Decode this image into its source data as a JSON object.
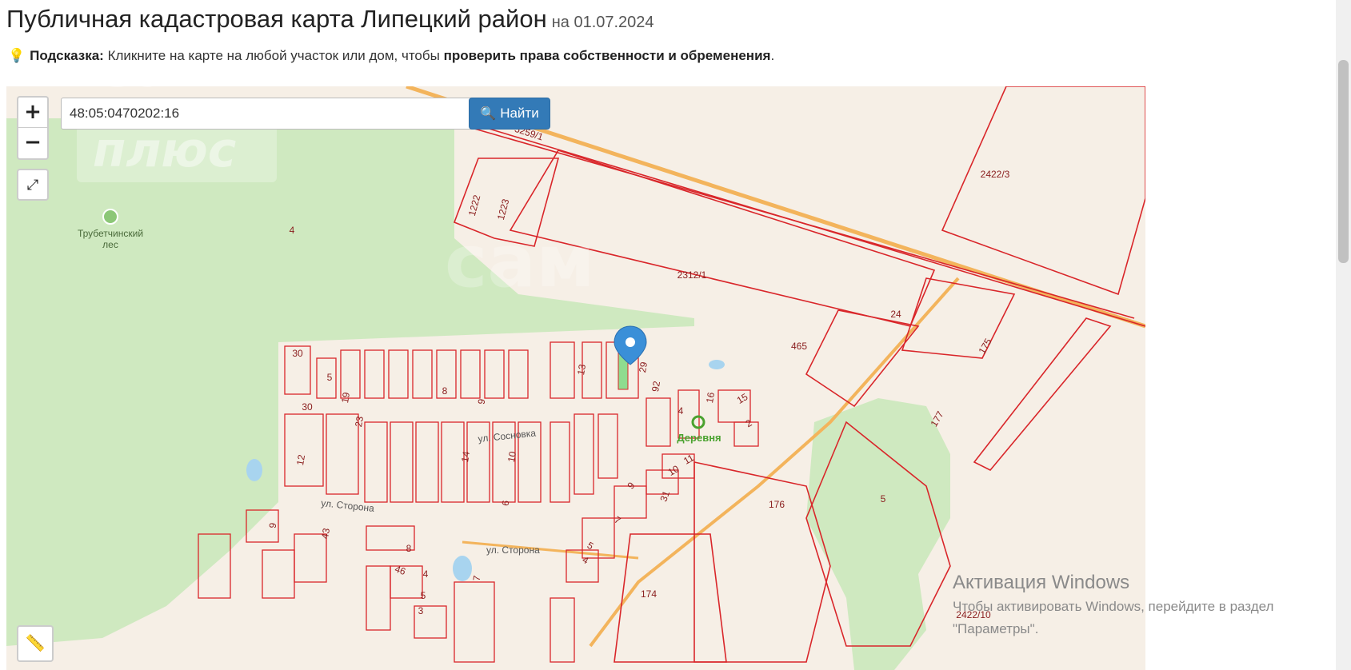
{
  "header": {
    "title": "Публичная кадастровая карта Липецкий район",
    "date": "на 01.07.2024"
  },
  "hint": {
    "icon": "lightbulb-icon",
    "label": "Подсказка:",
    "text": "Кликните на карте на любой участок или дом, чтобы",
    "bold": "проверить права собственности и обременения",
    "end": "."
  },
  "map": {
    "search": {
      "value": "48:05:0470202:16",
      "button_label": "Найти"
    },
    "controls": {
      "zoom_in": "+",
      "zoom_out": "−"
    },
    "colors": {
      "parcel": "#d9262a",
      "forest": "#cfe9c0",
      "land": "#f6efe6",
      "marker": "#3a8fd8",
      "road": "#f3b45c"
    },
    "forest_label": [
      "Трубетчинский",
      "лес"
    ],
    "village_label": "Деревня",
    "watermark": [
      "сам",
      "плюс"
    ],
    "streets": [
      "ул. Сосновка",
      "ул. Сторона",
      "ул. Сторона"
    ],
    "parcel_labels": [
      "4",
      "2312/1",
      "2422/3",
      "1222",
      "1223",
      "24",
      "465",
      "175",
      "177",
      "5259/1",
      "13",
      "29",
      "92",
      "30",
      "5",
      "19",
      "8",
      "9",
      "30",
      "23",
      "12",
      "14",
      "10",
      "6",
      "4",
      "16",
      "15",
      "2",
      "11",
      "10",
      "9",
      "31",
      "7",
      "5",
      "4",
      "176",
      "5",
      "174",
      "9",
      "43",
      "8",
      "46",
      "4",
      "5",
      "3",
      "7",
      "2422/10"
    ]
  },
  "windows_activation": {
    "title": "Активация Windows",
    "line1": "Чтобы активировать Windows, перейдите в раздел",
    "line2": "\"Параметры\"."
  }
}
